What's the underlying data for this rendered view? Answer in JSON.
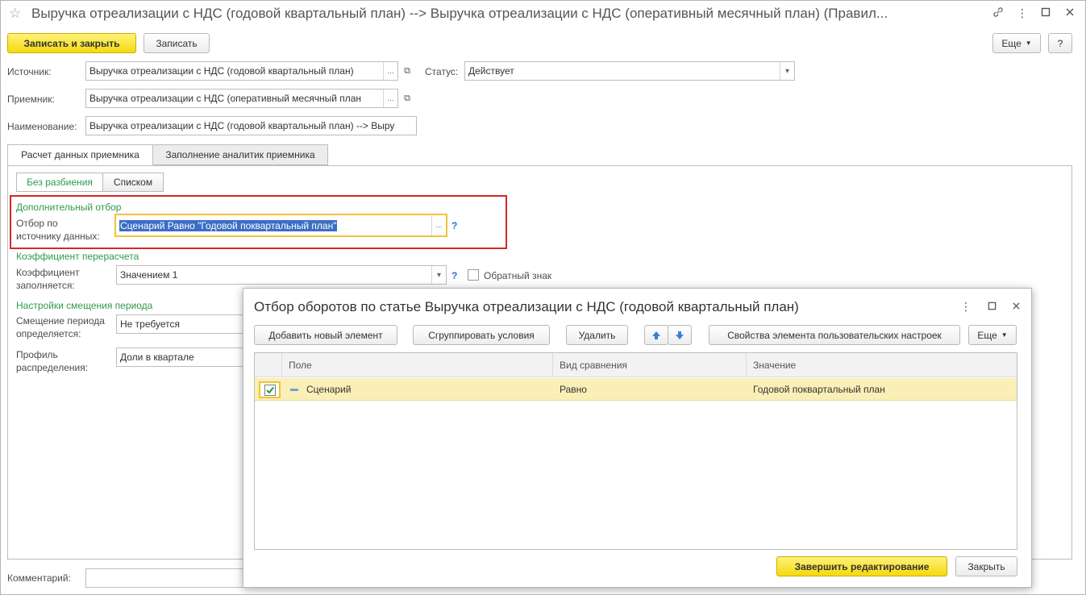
{
  "window": {
    "title": "Выручка отреализации с НДС (годовой квартальный план) --> Выручка отреализации с НДС (оперативный месячный план) (Правил...",
    "controls": [
      "link-icon",
      "more-icon",
      "minimize-icon",
      "maximize-icon",
      "close-icon"
    ]
  },
  "toolbar": {
    "save_close_label": "Записать и закрыть",
    "save_label": "Записать",
    "more_label": "Еще",
    "help_label": "?"
  },
  "form": {
    "source_label": "Источник:",
    "source_value": "Выручка отреализации с НДС (годовой квартальный план)",
    "receiver_label": "Приемник:",
    "receiver_value": "Выручка отреализации с НДС (оперативный месячный план",
    "name_label": "Наименование:",
    "name_value": "Выручка отреализации с НДС (годовой квартальный план) --> Выру",
    "status_label": "Статус:",
    "status_value": "Действует",
    "select_btn": "...",
    "comment_label": "Комментарий:"
  },
  "tabs": [
    {
      "label": "Расчет данных приемника",
      "active": true
    },
    {
      "label": "Заполнение аналитик приемника",
      "active": false
    }
  ],
  "segments": [
    "Без разбиения",
    "Списком"
  ],
  "filter_section": {
    "title": "Дополнительный отбор",
    "label_line1": "Отбор по",
    "label_line2": "источнику данных:",
    "value": "Сценарий Равно \"Годовой поквартальный план\"",
    "highlight_color": "#e03030"
  },
  "coef_section": {
    "title": "Коэффициент перерасчета",
    "label_line1": "Коэффициент",
    "label_line2": "заполняется:",
    "value": "Значением 1",
    "checkbox_label": "Обратный знак"
  },
  "period_section": {
    "title": "Настройки смещения периода",
    "shift_label_line1": "Смещение периода",
    "shift_label_line2": "определяется:",
    "shift_value": "Не требуется",
    "profile_label_line1": "Профиль",
    "profile_label_line2": "распределения:",
    "profile_value": "Доли в квартале"
  },
  "modal": {
    "title": "Отбор оборотов по статье Выручка отреализации с НДС (годовой квартальный план)",
    "buttons": {
      "add": "Добавить новый элемент",
      "group": "Сгруппировать условия",
      "delete": "Удалить",
      "properties": "Свойства элемента пользовательских настроек",
      "more": "Еще",
      "finish": "Завершить редактирование",
      "close": "Закрыть"
    },
    "columns": [
      "Поле",
      "Вид сравнения",
      "Значение"
    ],
    "rows": [
      {
        "checked": true,
        "field": "Сценарий",
        "comparison": "Равно",
        "value": "Годовой поквартальный план"
      }
    ]
  }
}
